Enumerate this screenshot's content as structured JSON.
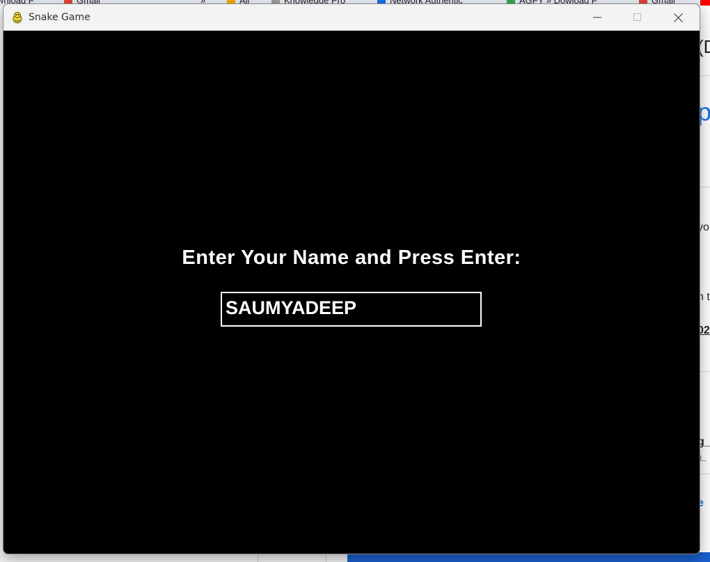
{
  "background_browser": {
    "bookmarks": [
      {
        "label": "wnload F",
        "icon": "page-icon",
        "color": "#5f6368"
      },
      {
        "label": "Gmail",
        "icon": "gmail-icon",
        "color": "#ea4335"
      },
      {
        "label": "»",
        "icon": "",
        "color": ""
      },
      {
        "label": "All",
        "icon": "folder-icon",
        "color": "#f9ab00"
      },
      {
        "label": "Knowledge Pro",
        "icon": "book-icon",
        "color": "#9e9e9e"
      },
      {
        "label": "Network Authentic",
        "icon": "s-icon",
        "color": "#1a73e8"
      },
      {
        "label": "AGFY » Dowload F",
        "icon": "leaf-icon",
        "color": "#34a853"
      },
      {
        "label": "Gmail",
        "icon": "gmail-icon",
        "color": "#ea4335"
      }
    ],
    "right_fragments": [
      "(D",
      "p",
      "yo",
      "n t",
      "02",
      "g_",
      "g_",
      "e"
    ]
  },
  "window": {
    "title": "Snake Game",
    "icon": "snake-game-icon",
    "controls": {
      "minimize": "minimize-icon",
      "maximize": "maximize-icon",
      "close": "close-icon"
    }
  },
  "game": {
    "prompt": "Enter Your Name and Press Enter:",
    "name_value": "SAUMYADEEP"
  },
  "colors": {
    "canvas": "#000000",
    "text": "#ffffff",
    "title_bar": "#f3f3f3"
  }
}
